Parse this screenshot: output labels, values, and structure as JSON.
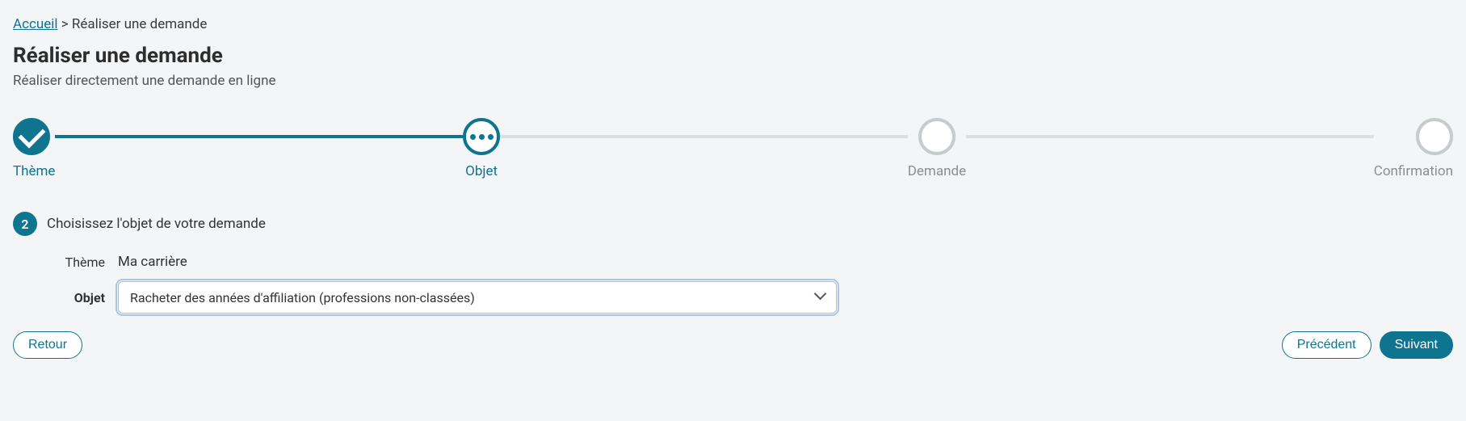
{
  "breadcrumb": {
    "home": "Accueil",
    "separator": ">",
    "current": "Réaliser une demande"
  },
  "page": {
    "title": "Réaliser une demande",
    "subtitle": "Réaliser directement une demande en ligne"
  },
  "stepper": {
    "steps": [
      {
        "label": "Thème",
        "state": "done"
      },
      {
        "label": "Objet",
        "state": "current"
      },
      {
        "label": "Demande",
        "state": "upcoming"
      },
      {
        "label": "Confirmation",
        "state": "upcoming"
      }
    ]
  },
  "section": {
    "number": "2",
    "title": "Choisissez l'objet de votre demande"
  },
  "form": {
    "theme_label": "Thème",
    "theme_value": "Ma carrière",
    "object_label": "Objet",
    "object_value": "Racheter des années d'affiliation (professions non-classées)"
  },
  "actions": {
    "back": "Retour",
    "previous": "Précédent",
    "next": "Suivant"
  }
}
